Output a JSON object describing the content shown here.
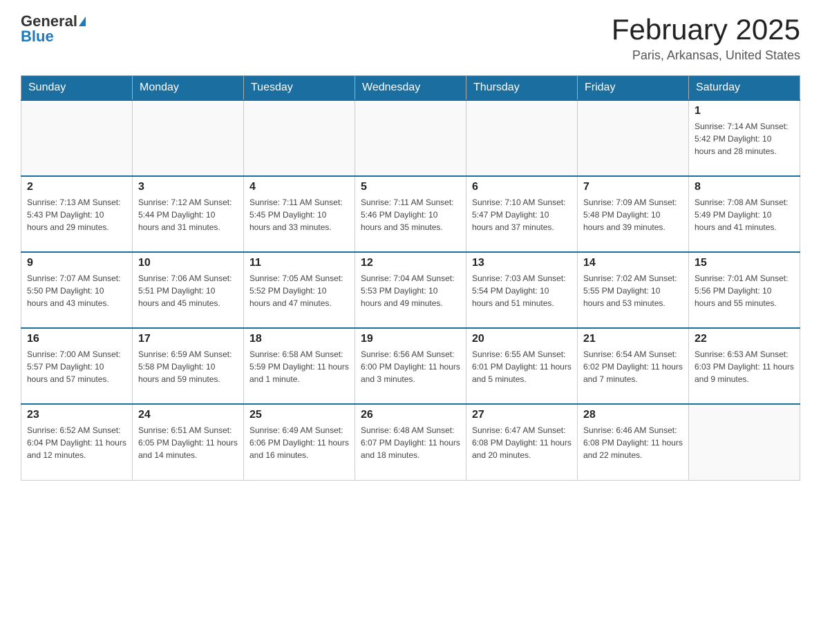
{
  "header": {
    "logo_general": "General",
    "logo_blue": "Blue",
    "month_title": "February 2025",
    "location": "Paris, Arkansas, United States"
  },
  "days_of_week": [
    "Sunday",
    "Monday",
    "Tuesday",
    "Wednesday",
    "Thursday",
    "Friday",
    "Saturday"
  ],
  "weeks": [
    [
      {
        "day": "",
        "info": ""
      },
      {
        "day": "",
        "info": ""
      },
      {
        "day": "",
        "info": ""
      },
      {
        "day": "",
        "info": ""
      },
      {
        "day": "",
        "info": ""
      },
      {
        "day": "",
        "info": ""
      },
      {
        "day": "1",
        "info": "Sunrise: 7:14 AM\nSunset: 5:42 PM\nDaylight: 10 hours and 28 minutes."
      }
    ],
    [
      {
        "day": "2",
        "info": "Sunrise: 7:13 AM\nSunset: 5:43 PM\nDaylight: 10 hours and 29 minutes."
      },
      {
        "day": "3",
        "info": "Sunrise: 7:12 AM\nSunset: 5:44 PM\nDaylight: 10 hours and 31 minutes."
      },
      {
        "day": "4",
        "info": "Sunrise: 7:11 AM\nSunset: 5:45 PM\nDaylight: 10 hours and 33 minutes."
      },
      {
        "day": "5",
        "info": "Sunrise: 7:11 AM\nSunset: 5:46 PM\nDaylight: 10 hours and 35 minutes."
      },
      {
        "day": "6",
        "info": "Sunrise: 7:10 AM\nSunset: 5:47 PM\nDaylight: 10 hours and 37 minutes."
      },
      {
        "day": "7",
        "info": "Sunrise: 7:09 AM\nSunset: 5:48 PM\nDaylight: 10 hours and 39 minutes."
      },
      {
        "day": "8",
        "info": "Sunrise: 7:08 AM\nSunset: 5:49 PM\nDaylight: 10 hours and 41 minutes."
      }
    ],
    [
      {
        "day": "9",
        "info": "Sunrise: 7:07 AM\nSunset: 5:50 PM\nDaylight: 10 hours and 43 minutes."
      },
      {
        "day": "10",
        "info": "Sunrise: 7:06 AM\nSunset: 5:51 PM\nDaylight: 10 hours and 45 minutes."
      },
      {
        "day": "11",
        "info": "Sunrise: 7:05 AM\nSunset: 5:52 PM\nDaylight: 10 hours and 47 minutes."
      },
      {
        "day": "12",
        "info": "Sunrise: 7:04 AM\nSunset: 5:53 PM\nDaylight: 10 hours and 49 minutes."
      },
      {
        "day": "13",
        "info": "Sunrise: 7:03 AM\nSunset: 5:54 PM\nDaylight: 10 hours and 51 minutes."
      },
      {
        "day": "14",
        "info": "Sunrise: 7:02 AM\nSunset: 5:55 PM\nDaylight: 10 hours and 53 minutes."
      },
      {
        "day": "15",
        "info": "Sunrise: 7:01 AM\nSunset: 5:56 PM\nDaylight: 10 hours and 55 minutes."
      }
    ],
    [
      {
        "day": "16",
        "info": "Sunrise: 7:00 AM\nSunset: 5:57 PM\nDaylight: 10 hours and 57 minutes."
      },
      {
        "day": "17",
        "info": "Sunrise: 6:59 AM\nSunset: 5:58 PM\nDaylight: 10 hours and 59 minutes."
      },
      {
        "day": "18",
        "info": "Sunrise: 6:58 AM\nSunset: 5:59 PM\nDaylight: 11 hours and 1 minute."
      },
      {
        "day": "19",
        "info": "Sunrise: 6:56 AM\nSunset: 6:00 PM\nDaylight: 11 hours and 3 minutes."
      },
      {
        "day": "20",
        "info": "Sunrise: 6:55 AM\nSunset: 6:01 PM\nDaylight: 11 hours and 5 minutes."
      },
      {
        "day": "21",
        "info": "Sunrise: 6:54 AM\nSunset: 6:02 PM\nDaylight: 11 hours and 7 minutes."
      },
      {
        "day": "22",
        "info": "Sunrise: 6:53 AM\nSunset: 6:03 PM\nDaylight: 11 hours and 9 minutes."
      }
    ],
    [
      {
        "day": "23",
        "info": "Sunrise: 6:52 AM\nSunset: 6:04 PM\nDaylight: 11 hours and 12 minutes."
      },
      {
        "day": "24",
        "info": "Sunrise: 6:51 AM\nSunset: 6:05 PM\nDaylight: 11 hours and 14 minutes."
      },
      {
        "day": "25",
        "info": "Sunrise: 6:49 AM\nSunset: 6:06 PM\nDaylight: 11 hours and 16 minutes."
      },
      {
        "day": "26",
        "info": "Sunrise: 6:48 AM\nSunset: 6:07 PM\nDaylight: 11 hours and 18 minutes."
      },
      {
        "day": "27",
        "info": "Sunrise: 6:47 AM\nSunset: 6:08 PM\nDaylight: 11 hours and 20 minutes."
      },
      {
        "day": "28",
        "info": "Sunrise: 6:46 AM\nSunset: 6:08 PM\nDaylight: 11 hours and 22 minutes."
      },
      {
        "day": "",
        "info": ""
      }
    ]
  ]
}
